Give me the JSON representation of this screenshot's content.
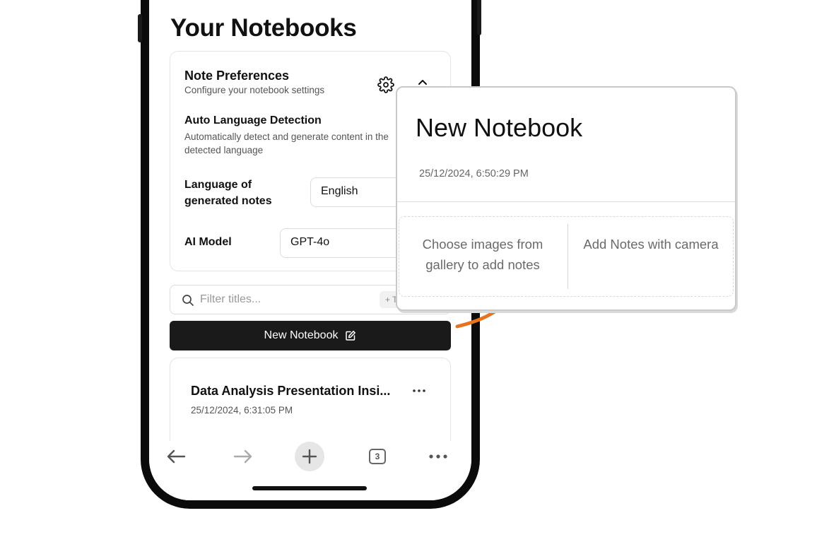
{
  "screen": {
    "title": "Your Notebooks",
    "preferences": {
      "title": "Note Preferences",
      "subtitle": "Configure your notebook settings",
      "auto_detection": {
        "title": "Auto Language Detection",
        "description": "Automatically detect and generate content in the detected language"
      },
      "language_label": "Language of generated notes",
      "language_value": "English",
      "model_label": "AI Model",
      "model_value": "GPT-4o"
    },
    "filter": {
      "placeholder": "Filter titles...",
      "tag_chip": "+ T"
    },
    "new_notebook_button": "New Notebook",
    "notebooks": [
      {
        "title": "Data Analysis Presentation Insi...",
        "date": "25/12/2024, 6:31:05 PM"
      }
    ],
    "browser_bar": {
      "tab_count": "3"
    }
  },
  "popup": {
    "title": "New Notebook",
    "date": "25/12/2024, 6:50:29 PM",
    "gallery_option": "Choose images from gallery to add notes",
    "camera_option": "Add Notes with camera"
  },
  "colors": {
    "accent_arrow": "#e8731f",
    "button_dark": "#1a1a1a"
  }
}
